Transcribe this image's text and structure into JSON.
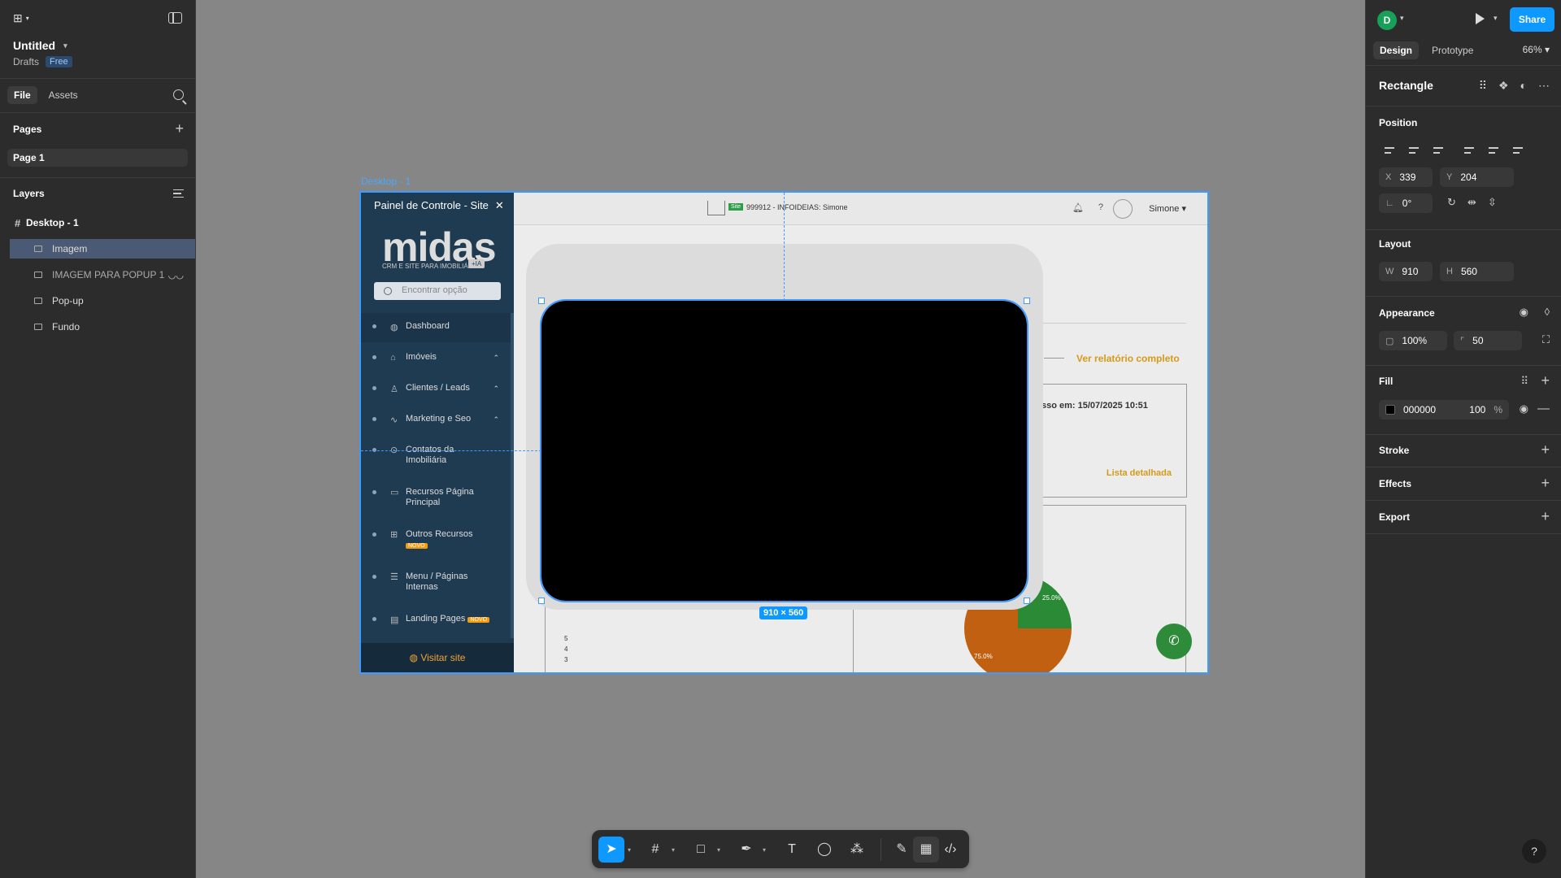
{
  "left_panel": {
    "file_name": "Untitled",
    "location": "Drafts",
    "plan_badge": "Free",
    "tabs": [
      "File",
      "Assets"
    ],
    "pages_heading": "Pages",
    "pages": [
      "Page 1"
    ],
    "layers_heading": "Layers",
    "layers": [
      {
        "name": "Desktop - 1",
        "type": "frame"
      },
      {
        "name": "Imagem",
        "type": "rectangle",
        "selected": true
      },
      {
        "name": "IMAGEM PARA POPUP 1",
        "type": "image",
        "hidden": true
      },
      {
        "name": "Pop-up",
        "type": "rectangle"
      },
      {
        "name": "Fundo",
        "type": "image"
      }
    ]
  },
  "right_panel": {
    "avatar_initial": "D",
    "share_label": "Share",
    "tabs": [
      "Design",
      "Prototype"
    ],
    "zoom": "66%",
    "selection_type": "Rectangle",
    "position_heading": "Position",
    "x_label": "X",
    "x_value": "339",
    "y_label": "Y",
    "y_value": "204",
    "rotation": "0°",
    "layout_heading": "Layout",
    "w_label": "W",
    "w_value": "910",
    "h_label": "H",
    "h_value": "560",
    "appearance_heading": "Appearance",
    "opacity": "100%",
    "corner_radius": "50",
    "fill_heading": "Fill",
    "fill_hex": "000000",
    "fill_opacity": "100",
    "fill_percent": "%",
    "stroke_heading": "Stroke",
    "effects_heading": "Effects",
    "export_heading": "Export"
  },
  "canvas": {
    "frame_label": "Desktop - 1",
    "size_badge": "910 × 560",
    "site": {
      "sidebar_title": "Painel de Controle - Site",
      "logo_text": "midas",
      "logo_sub": "CRM E SITE PARA IMOBILIÁRIA",
      "logo_ia": "+IA",
      "search_placeholder": "Encontrar opção",
      "menu": [
        {
          "label": "Dashboard"
        },
        {
          "label": "Imóveis"
        },
        {
          "label": "Clientes / Leads"
        },
        {
          "label": "Marketing e Seo"
        },
        {
          "label": "Contatos da Imobiliária"
        },
        {
          "label": "Recursos Página Principal"
        },
        {
          "label": "Outros Recursos"
        },
        {
          "label": "Menu / Páginas Internas"
        },
        {
          "label": "Landing Pages"
        }
      ],
      "novo_badge": "NOVO",
      "visit_site": "Visitar site",
      "topbar_badge": "Site",
      "topbar_text": "999912 - INFOIDEIAS: Simone",
      "user_name": "Simone",
      "report_link": "Ver relatório completo",
      "access_text": "sso em: 15/07/2025 10:51",
      "detail_link": "Lista detalhada",
      "axis_numbers": [
        "5",
        "4",
        "3"
      ],
      "pie_label_1": "25.0%",
      "pie_label_2": "75.0%"
    }
  },
  "colors": {
    "accent": "#0d99ff",
    "selection": "#3d9bff",
    "sidebar_bg": "#1f3b52",
    "gold": "#d49b16"
  }
}
